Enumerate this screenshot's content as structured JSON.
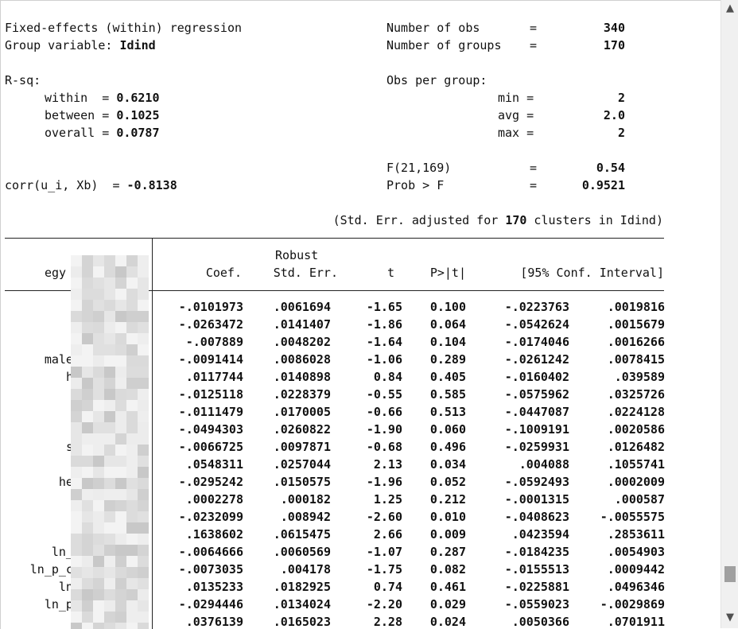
{
  "header": {
    "title": "Fixed-effects (within) regression",
    "group_label": "Group variable: ",
    "group_value": "Idind",
    "rsq_label": "R-sq:",
    "rsq_within_label": "within  =",
    "rsq_within": "0.6210",
    "rsq_between_label": "between =",
    "rsq_between": "0.1025",
    "rsq_overall_label": "overall =",
    "rsq_overall": "0.0787",
    "corr_label": "corr(u_i, Xb)  =",
    "corr_value": "-0.8138",
    "nobs_label": "Number of obs",
    "nobs": "340",
    "ngroups_label": "Number of groups",
    "ngroups": "170",
    "obs_per_group_label": "Obs per group:",
    "min_label": "min =",
    "min": "2",
    "avg_label": "avg =",
    "avg": "2.0",
    "max_label": "max =",
    "max": "2",
    "f_label": "F(21,169)",
    "f_value": "0.54",
    "probf_label": "Prob > F",
    "probf_value": "0.9521",
    "eq": "=",
    "cluster_note_pre": "(Std. Err. adjusted for ",
    "cluster_count": "170",
    "cluster_note_post": " clusters in Idind)"
  },
  "table": {
    "depvar_left": "egy",
    "depvar_right": "k",
    "robust_label": "Robust",
    "columns": [
      "Coef.",
      "Std. Err.",
      "t",
      "P>|t|",
      "[95% Conf. Interval]"
    ],
    "rows": [
      {
        "label_left": "",
        "label_right": "",
        "coef": "-.0101973",
        "se": ".0061694",
        "t": "-1.65",
        "p": "0.100",
        "lo": "-.0223763",
        "hi": ".0019816"
      },
      {
        "label_left": "",
        "label_right": "",
        "coef": "-.0263472",
        "se": ".0141407",
        "t": "-1.86",
        "p": "0.064",
        "lo": "-.0542624",
        "hi": ".0015679"
      },
      {
        "label_left": "m",
        "label_right": "",
        "coef": "-.007889",
        "se": ".0048202",
        "t": "-1.64",
        "p": "0.104",
        "lo": "-.0174046",
        "hi": ".0016266"
      },
      {
        "label_left": "male_",
        "label_right": "",
        "coef": "-.0091414",
        "se": ".0086028",
        "t": "-1.06",
        "p": "0.289",
        "lo": "-.0261242",
        "hi": ".0078415"
      },
      {
        "label_left": "hh",
        "label_right": "",
        "coef": ".0117744",
        "se": ".0140898",
        "t": "0.84",
        "p": "0.405",
        "lo": "-.0160402",
        "hi": ".039589"
      },
      {
        "label_left": "",
        "label_right": "",
        "coef": "-.0125118",
        "se": ".0228379",
        "t": "-0.55",
        "p": "0.585",
        "lo": "-.0575962",
        "hi": ".0325726"
      },
      {
        "label_left": "",
        "label_right": "",
        "coef": "-.0111479",
        "se": ".0170005",
        "t": "-0.66",
        "p": "0.513",
        "lo": "-.0447087",
        "hi": ".0224128"
      },
      {
        "label_left": "",
        "label_right": "",
        "coef": "-.0494303",
        "se": ".0260822",
        "t": "-1.90",
        "p": "0.060",
        "lo": "-.1009191",
        "hi": ".0020586"
      },
      {
        "label_left": "sm",
        "label_right": "3",
        "coef": "-.0066725",
        "se": ".0097871",
        "t": "-0.68",
        "p": "0.496",
        "lo": "-.0259931",
        "hi": ".0126482"
      },
      {
        "label_left": "",
        "label_right": "r",
        "coef": ".0548311",
        "se": ".0257044",
        "t": "2.13",
        "p": "0.034",
        "lo": ".004088",
        "hi": ".1055741"
      },
      {
        "label_left": "hea",
        "label_right": "e",
        "coef": "-.0295242",
        "se": ".0150575",
        "t": "-1.96",
        "p": "0.052",
        "lo": "-.0592493",
        "hi": ".0002009"
      },
      {
        "label_left": "",
        "label_right": "e",
        "coef": ".0002278",
        "se": ".000182",
        "t": "1.25",
        "p": "0.212",
        "lo": "-.0001315",
        "hi": ".000587"
      },
      {
        "label_left": "",
        "label_right": "cp",
        "coef": "-.0232099",
        "se": ".008942",
        "t": "-2.60",
        "p": "0.010",
        "lo": "-.0408623",
        "hi": "-.0055575"
      },
      {
        "label_left": "",
        "label_right": "ex",
        "coef": ".1638602",
        "se": ".0615475",
        "t": "2.66",
        "p": "0.009",
        "lo": ".0423594",
        "hi": ".2853611"
      },
      {
        "label_left": "ln_p",
        "label_right": "04",
        "coef": "-.0064666",
        "se": ".0060569",
        "t": "-1.07",
        "p": "0.287",
        "lo": "-.0184235",
        "hi": ".0054903"
      },
      {
        "label_left": "ln_p_ca",
        "label_right": "04",
        "coef": "-.0073035",
        "se": ".004178",
        "t": "-1.75",
        "p": "0.082",
        "lo": "-.0155513",
        "hi": ".0009442"
      },
      {
        "label_left": "ln_",
        "label_right": "04",
        "coef": ".0135233",
        "se": ".0182925",
        "t": "0.74",
        "p": "0.461",
        "lo": "-.0225881",
        "hi": ".0496346"
      },
      {
        "label_left": "ln_p_",
        "label_right": "004",
        "coef": "-.0294446",
        "se": ".0134024",
        "t": "-2.20",
        "p": "0.029",
        "lo": "-.0559023",
        "hi": "-.0029869"
      },
      {
        "label_left": "",
        "label_right": "006",
        "coef": ".0376139",
        "se": ".0165023",
        "t": "2.28",
        "p": "0.024",
        "lo": ".0050366",
        "hi": ".0701911"
      }
    ]
  },
  "scrollbar": {
    "up_icon": "▲",
    "down_icon": "▼",
    "position_fraction": 0.95
  }
}
